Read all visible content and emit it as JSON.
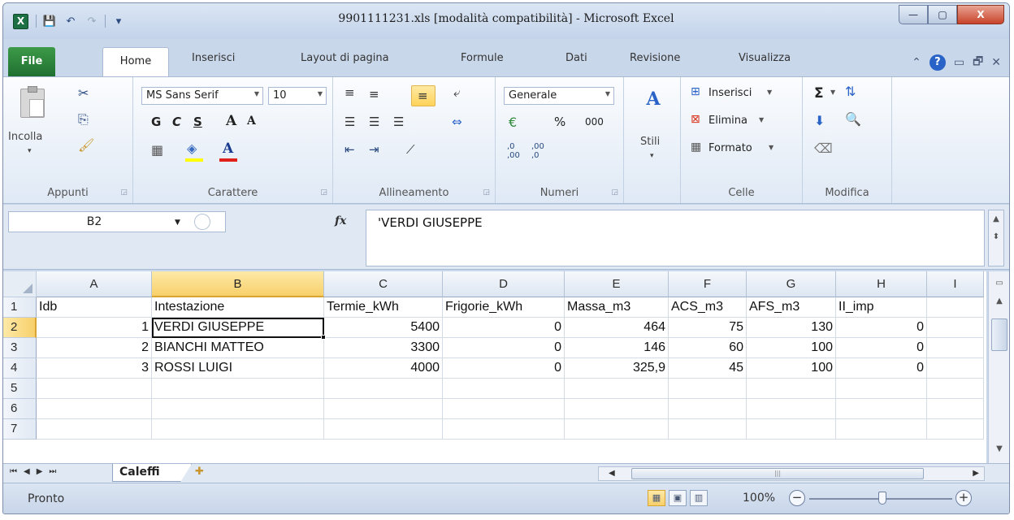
{
  "window": {
    "title": "9901111231.xls  [modalità compatibilità]  -  Microsoft Excel",
    "app_icon": "X",
    "controls": [
      "—",
      "▢",
      "X"
    ]
  },
  "qat": {
    "save_icon": "💾",
    "undo_icon": "↶",
    "redo_icon": "↷",
    "customize_icon": "▾"
  },
  "tabs": {
    "file": "File",
    "items": [
      "Home",
      "Inserisci",
      "Layout di pagina",
      "Formule",
      "Dati",
      "Revisione",
      "Visualizza"
    ],
    "right_icons": {
      "minimize_ribbon": "⌃",
      "help": "?",
      "restore": "▭",
      "window": "🗗",
      "close": "✕"
    }
  },
  "ribbon": {
    "appunti": {
      "label": "Appunti",
      "paste": "Incolla",
      "cut_icon": "✂",
      "copy_icon": "⎘",
      "format_painter_icon": "🖌"
    },
    "carattere": {
      "label": "Carattere",
      "font": "MS Sans Serif",
      "size": "10",
      "bold": "G",
      "italic": "C",
      "underline": "S",
      "grow": "A",
      "shrink": "A",
      "font_color": "A",
      "fill_icon": "◈",
      "borders_icon": "▦"
    },
    "allineamento": {
      "label": "Allineamento",
      "orient_icon": "⟋",
      "wrap_icon": "⤶",
      "merge_icon": "⇔"
    },
    "numeri": {
      "label": "Numeri",
      "format": "Generale",
      "currency_icon": "€",
      "percent": "%",
      "thousands": "000",
      "inc_dec": ",0\n,00",
      "dec_dec": ",00\n,0"
    },
    "stili": {
      "label": "Stili",
      "icon": "A"
    },
    "celle": {
      "label": "Celle",
      "insert": "Inserisci",
      "delete": "Elimina",
      "format": "Formato"
    },
    "modifica": {
      "label": "Modifica",
      "sum": "Σ",
      "sort": "⇅",
      "find": "🔍",
      "fill_icon": "⬇",
      "clear_icon": "⌫"
    }
  },
  "formula_bar": {
    "name_box": "B2",
    "fx": "fx",
    "content": "'VERDI GIUSEPPE"
  },
  "grid": {
    "columns": [
      "A",
      "B",
      "C",
      "D",
      "E",
      "F",
      "G",
      "H",
      "I"
    ],
    "rows": [
      "1",
      "2",
      "3",
      "4",
      "5",
      "6",
      "7"
    ],
    "header_row": [
      "Idb",
      "Intestazione",
      "Termie_kWh",
      "Frigorie_kWh",
      "Massa_m3",
      "ACS_m3",
      "AFS_m3",
      "II_imp"
    ],
    "data": [
      [
        "1",
        "VERDI GIUSEPPE",
        "5400",
        "0",
        "464",
        "75",
        "130",
        "0"
      ],
      [
        "2",
        "BIANCHI MATTEO",
        "3300",
        "0",
        "146",
        "60",
        "100",
        "0"
      ],
      [
        "3",
        "ROSSI LUIGI",
        "4000",
        "0",
        "325,9",
        "45",
        "100",
        "0"
      ]
    ],
    "active_cell": "B2"
  },
  "sheets": {
    "active": "Caleffi",
    "new_sheet_icon": "✚"
  },
  "status": {
    "text": "Pronto",
    "zoom": "100%",
    "zoom_level": 1.0
  }
}
